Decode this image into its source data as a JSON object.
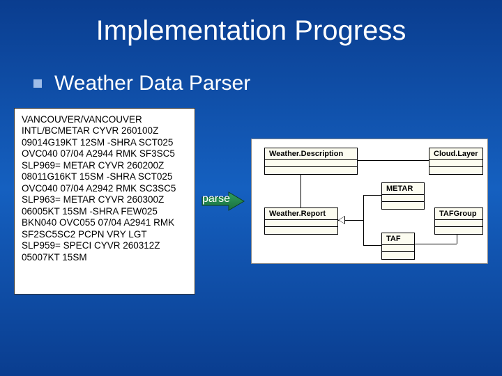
{
  "title": "Implementation Progress",
  "subtitle": "Weather Data Parser",
  "raw_text": "VANCOUVER/VANCOUVER INTL/BCMETAR CYVR 260100Z 09014G19KT 12SM -SHRA SCT025 OVC040 07/04 A2944 RMK SF3SC5 SLP969= METAR CYVR 260200Z 08011G16KT 15SM -SHRA SCT025 OVC040 07/04 A2942 RMK SC3SC5 SLP963= METAR CYVR 260300Z 06005KT 15SM -SHRA FEW025 BKN040 OVC055 07/04 A2941 RMK SF2SC5SC2 PCPN VRY LGT SLP959= SPECI CYVR 260312Z 05007KT 15SM",
  "arrow_label": "parse",
  "uml": {
    "weather_description": "Weather.Description",
    "cloud_layer": "Cloud.Layer",
    "weather_report": "Weather.Report",
    "metar": "METAR",
    "taf": "TAF",
    "taf_group": "TAFGroup"
  }
}
